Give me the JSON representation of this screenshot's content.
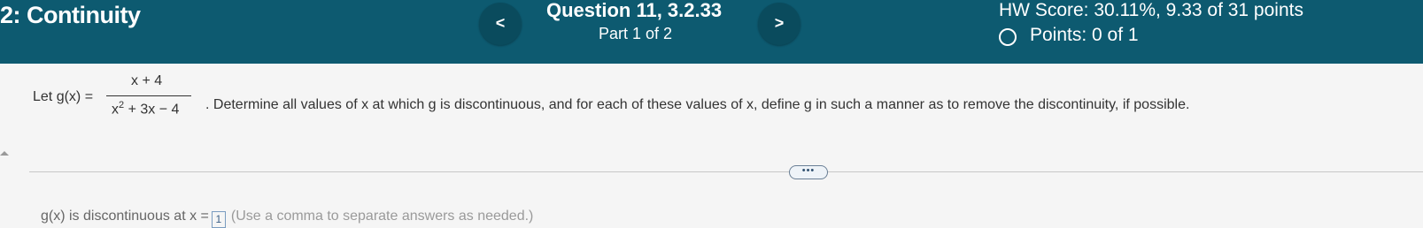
{
  "header": {
    "section_title": "2: Continuity",
    "question_title": "Question 11, 3.2.33",
    "part": "Part 1 of 2",
    "prev_label": "<",
    "next_label": ">",
    "hw_score": "HW Score: 30.11%, 9.33 of 31 points",
    "points": "Points: 0 of 1"
  },
  "question": {
    "let_text": "Let g(x) =",
    "numerator": "x + 4",
    "denominator_base": "x",
    "denominator_exp": "2",
    "denominator_rest": " + 3x − 4",
    "instruction": ". Determine all values of x at which g is discontinuous, and for each of these values of x, define g in such a manner as to remove the discontinuity, if possible.",
    "ellipsis": "•••"
  },
  "answer": {
    "prefix": "g(x) is discontinuous at x =",
    "box_value": "1",
    "hint": "(Use a comma to separate answers as needed.)"
  },
  "colors": {
    "header_bg": "#0d5a70",
    "page_bg": "#f5f5f5"
  }
}
